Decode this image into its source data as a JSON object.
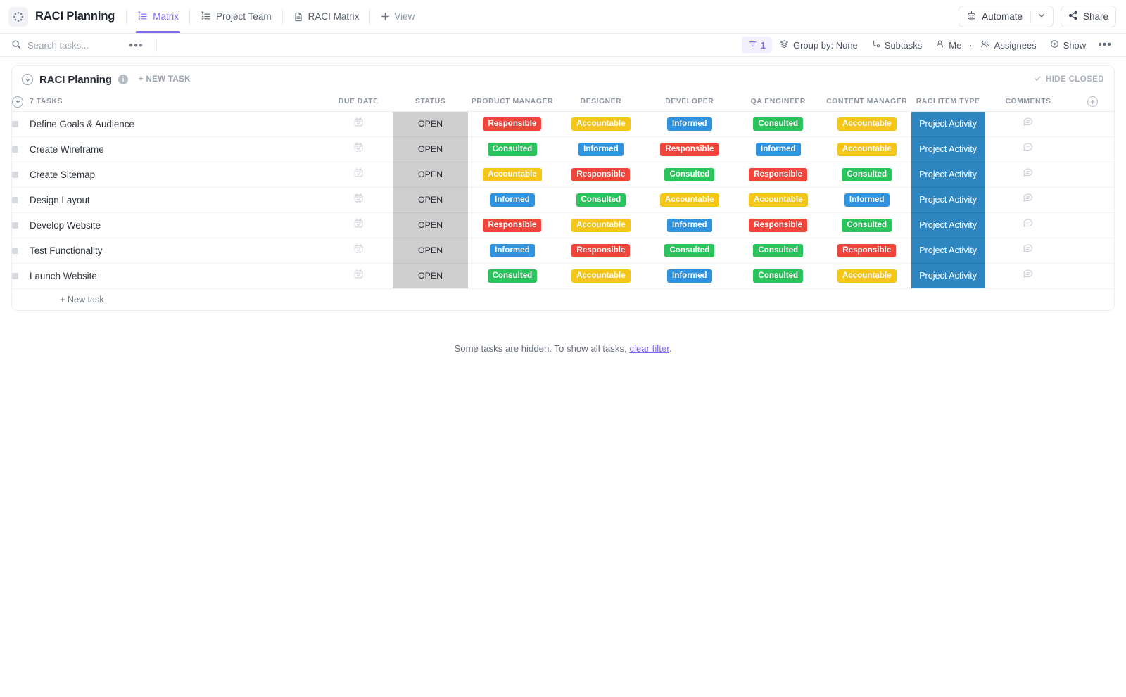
{
  "topbar": {
    "logo_icon": "clickup-dots-logo-icon",
    "space_title": "RACI Planning",
    "tabs": [
      {
        "label": "Matrix",
        "icon": "list-pin-icon",
        "active": true
      },
      {
        "label": "Project Team",
        "icon": "list-pin-icon",
        "active": false
      },
      {
        "label": "RACI Matrix",
        "icon": "doc-icon",
        "active": false
      }
    ],
    "add_view_label": "View",
    "automate_label": "Automate",
    "share_label": "Share"
  },
  "filterbar": {
    "search_placeholder": "Search tasks...",
    "search_value": "",
    "more_label": "•••",
    "filter_count": "1",
    "group_by_label": "Group by: None",
    "subtasks_label": "Subtasks",
    "me_label": "Me",
    "assignees_label": "Assignees",
    "show_label": "Show",
    "overflow_label": "•••"
  },
  "group": {
    "title": "RACI Planning",
    "info_char": "i",
    "new_task_label": "+ NEW TASK",
    "hide_closed_label": "HIDE CLOSED",
    "task_count_label": "7 TASKS",
    "add_task_footer": "+ New task"
  },
  "columns": {
    "due_date": "DUE DATE",
    "status": "STATUS",
    "product_manager": "PRODUCT MANAGER",
    "designer": "DESIGNER",
    "developer": "DEVELOPER",
    "qa_engineer": "QA ENGINEER",
    "content_manager": "CONTENT MANAGER",
    "raci_item_type": "RACI ITEM TYPE",
    "comments": "COMMENTS"
  },
  "colors": {
    "responsible": "#f0453a",
    "accountable": "#f5c518",
    "informed": "#2f93e0",
    "consulted": "#2bc35c",
    "raci_item_type_cell": "#2e86c1",
    "status_cell": "#cfcfcf",
    "accent": "#7b68ee"
  },
  "rows": [
    {
      "name": "Define Goals & Audience",
      "due_date": "",
      "status": "OPEN",
      "product_manager": "Responsible",
      "designer": "Accountable",
      "developer": "Informed",
      "qa_engineer": "Consulted",
      "content_manager": "Accountable",
      "raci_item_type": "Project Activity"
    },
    {
      "name": "Create Wireframe",
      "due_date": "",
      "status": "OPEN",
      "product_manager": "Consulted",
      "designer": "Informed",
      "developer": "Responsible",
      "qa_engineer": "Informed",
      "content_manager": "Accountable",
      "raci_item_type": "Project Activity"
    },
    {
      "name": "Create Sitemap",
      "due_date": "",
      "status": "OPEN",
      "product_manager": "Accountable",
      "designer": "Responsible",
      "developer": "Consulted",
      "qa_engineer": "Responsible",
      "content_manager": "Consulted",
      "raci_item_type": "Project Activity"
    },
    {
      "name": "Design Layout",
      "due_date": "",
      "status": "OPEN",
      "product_manager": "Informed",
      "designer": "Consulted",
      "developer": "Accountable",
      "qa_engineer": "Accountable",
      "content_manager": "Informed",
      "raci_item_type": "Project Activity"
    },
    {
      "name": "Develop Website",
      "due_date": "",
      "status": "OPEN",
      "product_manager": "Responsible",
      "designer": "Accountable",
      "developer": "Informed",
      "qa_engineer": "Responsible",
      "content_manager": "Consulted",
      "raci_item_type": "Project Activity"
    },
    {
      "name": "Test Functionality",
      "due_date": "",
      "status": "OPEN",
      "product_manager": "Informed",
      "designer": "Responsible",
      "developer": "Consulted",
      "qa_engineer": "Consulted",
      "content_manager": "Responsible",
      "raci_item_type": "Project Activity"
    },
    {
      "name": "Launch Website",
      "due_date": "",
      "status": "OPEN",
      "product_manager": "Consulted",
      "designer": "Accountable",
      "developer": "Informed",
      "qa_engineer": "Consulted",
      "content_manager": "Accountable",
      "raci_item_type": "Project Activity"
    }
  ],
  "footer": {
    "hidden_prefix": "Some tasks are hidden. To show all tasks,",
    "clear_filter_label": "clear filter",
    "hidden_suffix": "."
  }
}
